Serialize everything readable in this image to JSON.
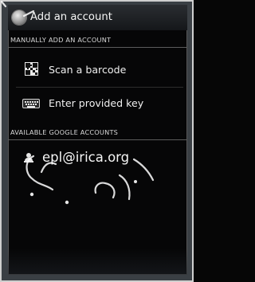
{
  "dialog": {
    "title": "Add an account",
    "sections": {
      "manual_header": "MANUALLY ADD AN ACCOUNT",
      "google_header": "AVAILABLE GOOGLE ACCOUNTS"
    },
    "manual_options": [
      {
        "label": "Scan a barcode",
        "icon": "barcode-icon"
      },
      {
        "label": "Enter provided key",
        "icon": "keyboard-icon"
      }
    ],
    "google_accounts": [
      {
        "label": "epl@irica.org",
        "icon": "person-icon"
      }
    ]
  },
  "colors": {
    "background": "#060606",
    "text": "#f2f2f2",
    "divider": "#5c5c5c"
  }
}
